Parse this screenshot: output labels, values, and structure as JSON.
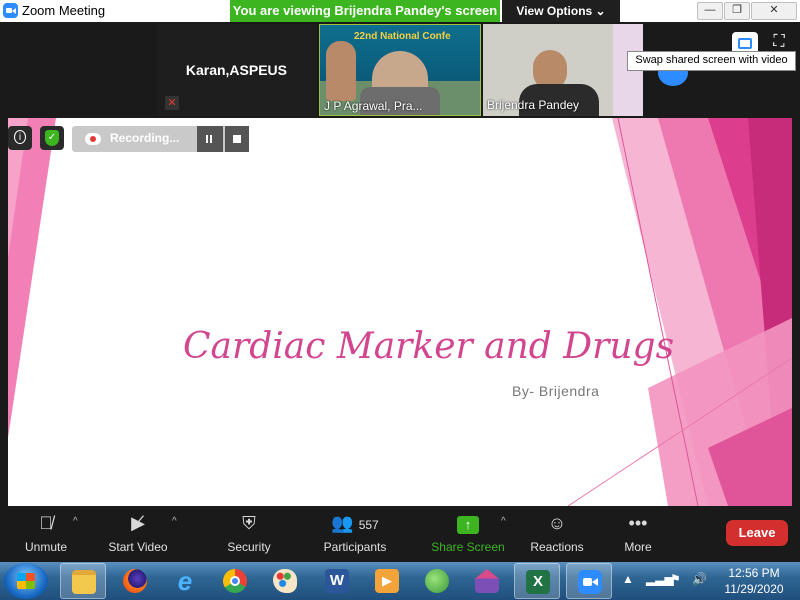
{
  "titlebar": {
    "app_title": "Zoom Meeting",
    "viewing_banner": "You are viewing Brijendra Pandey's screen",
    "view_options": "View Options ⌄",
    "minimize": "—",
    "restore": "❐",
    "close": "✕"
  },
  "videos": {
    "self_name": "Karan,ASPEUS",
    "tile1_name": "J P Agrawal, Pra...",
    "tile1_banner": "22nd National Confe",
    "tile2_name": "Brijendra Pandey"
  },
  "tooltip": "Swap shared screen with video",
  "recording": {
    "label": "Recording..."
  },
  "slide": {
    "title": "Cardiac Marker and Drugs",
    "author": "By- Brijendra"
  },
  "toolbar": {
    "unmute": "Unmute",
    "start_video": "Start Video",
    "security": "Security",
    "participants": "Participants",
    "participants_count": "557",
    "share_screen": "Share Screen",
    "reactions": "Reactions",
    "more": "More",
    "leave": "Leave"
  },
  "taskbar": {
    "time": "12:56 PM",
    "date": "11/29/2020"
  },
  "colors": {
    "zoom_blue": "#2d8cff",
    "banner_green": "#3cb521",
    "slide_pink": "#d1468f",
    "leave_red": "#d32f2f"
  }
}
